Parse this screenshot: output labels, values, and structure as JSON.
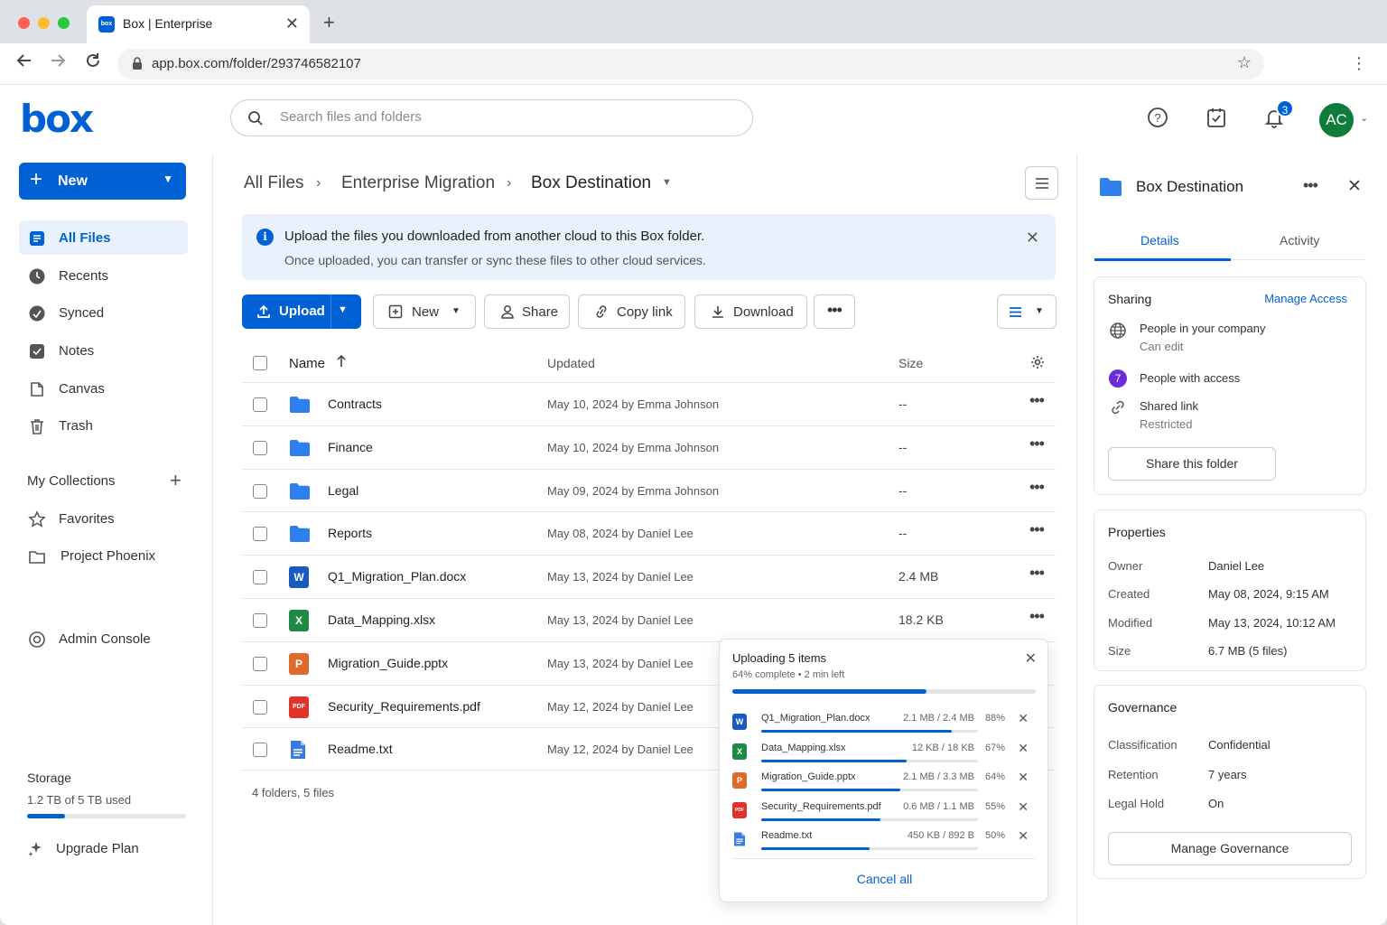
{
  "browser": {
    "tab_title": "Box | Enterprise",
    "favicon_text": "box",
    "url": "app.box.com/folder/293746582107"
  },
  "header": {
    "logo": "box",
    "search_placeholder": "Search files and folders",
    "notification_count": "3",
    "avatar_initials": "AC"
  },
  "sidebar": {
    "new_label": "New",
    "items": [
      {
        "label": "All Files",
        "icon": "all-files-icon"
      },
      {
        "label": "Recents",
        "icon": "clock-icon"
      },
      {
        "label": "Synced",
        "icon": "synced-icon"
      },
      {
        "label": "Notes",
        "icon": "notes-icon"
      },
      {
        "label": "Canvas",
        "icon": "canvas-icon"
      },
      {
        "label": "Trash",
        "icon": "trash-icon"
      }
    ],
    "collections_title": "My Collections",
    "collections": [
      {
        "label": "Favorites",
        "icon": "star-icon"
      },
      {
        "label": "Project Phoenix",
        "icon": "folder-outline-icon"
      }
    ],
    "admin_label": "Admin Console",
    "storage_title": "Storage",
    "storage_text": "1.2 TB of 5 TB used",
    "storage_fraction": 0.24,
    "upgrade_label": "Upgrade Plan"
  },
  "breadcrumb": {
    "items": [
      "All Files",
      "Enterprise Migration",
      "Box Destination"
    ]
  },
  "banner": {
    "title": "Upload the files you downloaded from another cloud to this Box folder.",
    "body": "Once uploaded, you can transfer or sync these files to other cloud services."
  },
  "toolbar": {
    "upload": "Upload",
    "new": "New",
    "share": "Share",
    "copy_link": "Copy link",
    "download": "Download"
  },
  "table": {
    "columns": {
      "name": "Name",
      "updated": "Updated",
      "size": "Size"
    },
    "rows": [
      {
        "name": "Contracts",
        "type": "folder",
        "updated": "May 10, 2024",
        "by": "by Emma Johnson",
        "size": "--"
      },
      {
        "name": "Finance",
        "type": "folder",
        "updated": "May 10, 2024",
        "by": "by Emma Johnson",
        "size": "--"
      },
      {
        "name": "Legal",
        "type": "folder",
        "updated": "May 09, 2024",
        "by": "by Emma Johnson",
        "size": "--"
      },
      {
        "name": "Reports",
        "type": "folder",
        "updated": "May 08, 2024",
        "by": "by Daniel Lee",
        "size": "--"
      },
      {
        "name": "Q1_Migration_Plan.docx",
        "type": "word",
        "updated": "May 13, 2024",
        "by": "by Daniel Lee",
        "size": "2.4 MB"
      },
      {
        "name": "Data_Mapping.xlsx",
        "type": "excel",
        "updated": "May 13, 2024",
        "by": "by Daniel Lee",
        "size": "18.2 KB"
      },
      {
        "name": "Migration_Guide.pptx",
        "type": "powerpoint",
        "updated": "May 13, 2024",
        "by": "by Daniel Lee",
        "size": ""
      },
      {
        "name": "Security_Requirements.pdf",
        "type": "pdf",
        "updated": "May 12, 2024",
        "by": "by Daniel Lee",
        "size": ""
      },
      {
        "name": "Readme.txt",
        "type": "text",
        "updated": "May 12, 2024",
        "by": "by Daniel Lee",
        "size": ""
      }
    ],
    "summary": "4 folders, 5 files"
  },
  "upload_panel": {
    "title": "Uploading 5 items",
    "status": "64% complete  •  2 min left",
    "progress": 0.64,
    "items": [
      {
        "name": "Q1_Migration_Plan.docx",
        "type": "word",
        "size": "2.1 MB / 2.4 MB",
        "pct": "88%",
        "progress": 0.88
      },
      {
        "name": "Data_Mapping.xlsx",
        "type": "excel",
        "size": "12 KB / 18 KB",
        "pct": "67%",
        "progress": 0.67
      },
      {
        "name": "Migration_Guide.pptx",
        "type": "powerpoint",
        "size": "2.1 MB / 3.3 MB",
        "pct": "64%",
        "progress": 0.64
      },
      {
        "name": "Security_Requirements.pdf",
        "type": "pdf",
        "size": "0.6 MB / 1.1 MB",
        "pct": "55%",
        "progress": 0.55
      },
      {
        "name": "Readme.txt",
        "type": "text",
        "size": "450 KB / 892 B",
        "pct": "50%",
        "progress": 0.5
      }
    ],
    "cancel_all": "Cancel all"
  },
  "details": {
    "title": "Box Destination",
    "tabs": [
      "Details",
      "Activity"
    ],
    "sharing": {
      "title": "Sharing",
      "manage": "Manage Access",
      "company": "People in your company",
      "company_perm": "Can edit",
      "people_count": "7",
      "people": "People with access",
      "link": "Shared link",
      "link_status": "Restricted",
      "share_button": "Share this folder"
    },
    "properties": {
      "title": "Properties",
      "rows": [
        {
          "k": "Owner",
          "v": "Daniel Lee"
        },
        {
          "k": "Created",
          "v": "May 08, 2024, 9:15 AM"
        },
        {
          "k": "Modified",
          "v": "May 13, 2024, 10:12 AM"
        },
        {
          "k": "Size",
          "v": "6.7 MB (5 files)"
        }
      ]
    },
    "governance": {
      "title": "Governance",
      "rows": [
        {
          "k": "Classification",
          "v": "Confidential"
        },
        {
          "k": "Retention",
          "v": "7 years"
        },
        {
          "k": "Legal Hold",
          "v": "On"
        }
      ],
      "button": "Manage Governance"
    }
  },
  "colors": {
    "accent": "#0061d5",
    "folder": "#2f80ed",
    "word": "#185abd",
    "excel": "#1e8a44",
    "powerpoint": "#e06a2c",
    "pdf": "#e0342a",
    "text": "#3a7be0"
  }
}
